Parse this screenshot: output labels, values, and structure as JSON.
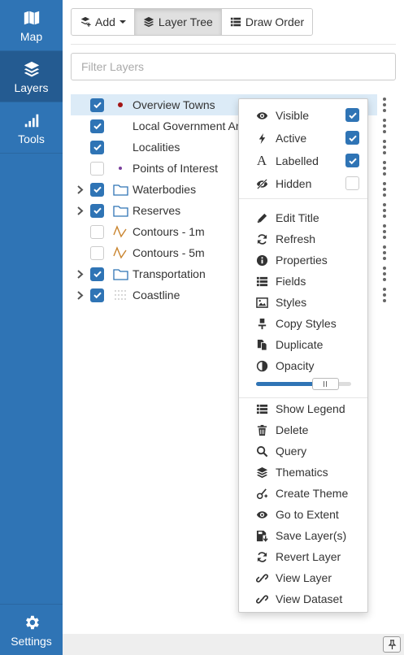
{
  "nav": {
    "map_label": "Map",
    "layers_label": "Layers",
    "tools_label": "Tools",
    "settings_label": "Settings",
    "active": "Layers"
  },
  "toolbar": {
    "add_label": "Add",
    "layer_tree_label": "Layer Tree",
    "draw_order_label": "Draw Order",
    "active_tab": "Layer Tree"
  },
  "filter": {
    "placeholder": "Filter Layers",
    "value": ""
  },
  "layers": [
    {
      "name": "Overview Towns",
      "checked": true,
      "expandable": false,
      "icon": "red-dot-point-icon",
      "highlighted": true
    },
    {
      "name": "Local Government Areas",
      "checked": true,
      "expandable": false,
      "icon": "none"
    },
    {
      "name": "Localities",
      "checked": true,
      "expandable": false,
      "icon": "none"
    },
    {
      "name": "Points of Interest",
      "checked": false,
      "expandable": false,
      "icon": "purple-dot-point-icon"
    },
    {
      "name": "Waterbodies",
      "checked": true,
      "expandable": true,
      "icon": "folder-icon"
    },
    {
      "name": "Reserves",
      "checked": true,
      "expandable": true,
      "icon": "folder-icon"
    },
    {
      "name": "Contours - 1m",
      "checked": false,
      "expandable": false,
      "icon": "line-style-icon"
    },
    {
      "name": "Contours - 5m",
      "checked": false,
      "expandable": false,
      "icon": "line-style-icon"
    },
    {
      "name": "Transportation",
      "checked": true,
      "expandable": true,
      "icon": "folder-icon"
    },
    {
      "name": "Coastline",
      "checked": true,
      "expandable": true,
      "icon": "dotted-grid-icon"
    }
  ],
  "context_menu": {
    "toggles": [
      {
        "label": "Visible",
        "icon": "eye-icon",
        "checked": true
      },
      {
        "label": "Active",
        "icon": "bolt-icon",
        "checked": true
      },
      {
        "label": "Labelled",
        "icon": "font-icon",
        "checked": true
      },
      {
        "label": "Hidden",
        "icon": "eye-slash-icon",
        "checked": false
      }
    ],
    "actions": [
      {
        "label": "Edit Title",
        "icon": "pencil-icon"
      },
      {
        "label": "Refresh",
        "icon": "refresh-icon"
      },
      {
        "label": "Properties",
        "icon": "info-circle-icon"
      },
      {
        "label": "Fields",
        "icon": "list-icon"
      },
      {
        "label": "Styles",
        "icon": "image-icon"
      },
      {
        "label": "Copy Styles",
        "icon": "paint-copy-icon"
      },
      {
        "label": "Duplicate",
        "icon": "copy-icon"
      },
      {
        "label": "Opacity",
        "icon": "half-circle-icon"
      }
    ],
    "opacity": 0.73,
    "more_actions": [
      {
        "label": "Show Legend",
        "icon": "list-icon"
      },
      {
        "label": "Delete",
        "icon": "trash-icon"
      },
      {
        "label": "Query",
        "icon": "search-icon"
      },
      {
        "label": "Thematics",
        "icon": "layers-icon"
      },
      {
        "label": "Create Theme",
        "icon": "create-theme-icon"
      },
      {
        "label": "Go to Extent",
        "icon": "eye-icon"
      },
      {
        "label": "Save Layer(s)",
        "icon": "save-icon"
      },
      {
        "label": "Revert Layer",
        "icon": "refresh-icon"
      },
      {
        "label": "View Layer",
        "icon": "link-icon"
      },
      {
        "label": "View Dataset",
        "icon": "link-icon"
      }
    ]
  },
  "colors": {
    "primary": "#2f74b5",
    "nav_active": "#245b91",
    "highlight_row": "#dcebf7",
    "point_red": "#a31515",
    "point_purple": "#7a3f9c",
    "folder_blue": "#2f74b5",
    "contour_orange": "#c9842e"
  }
}
